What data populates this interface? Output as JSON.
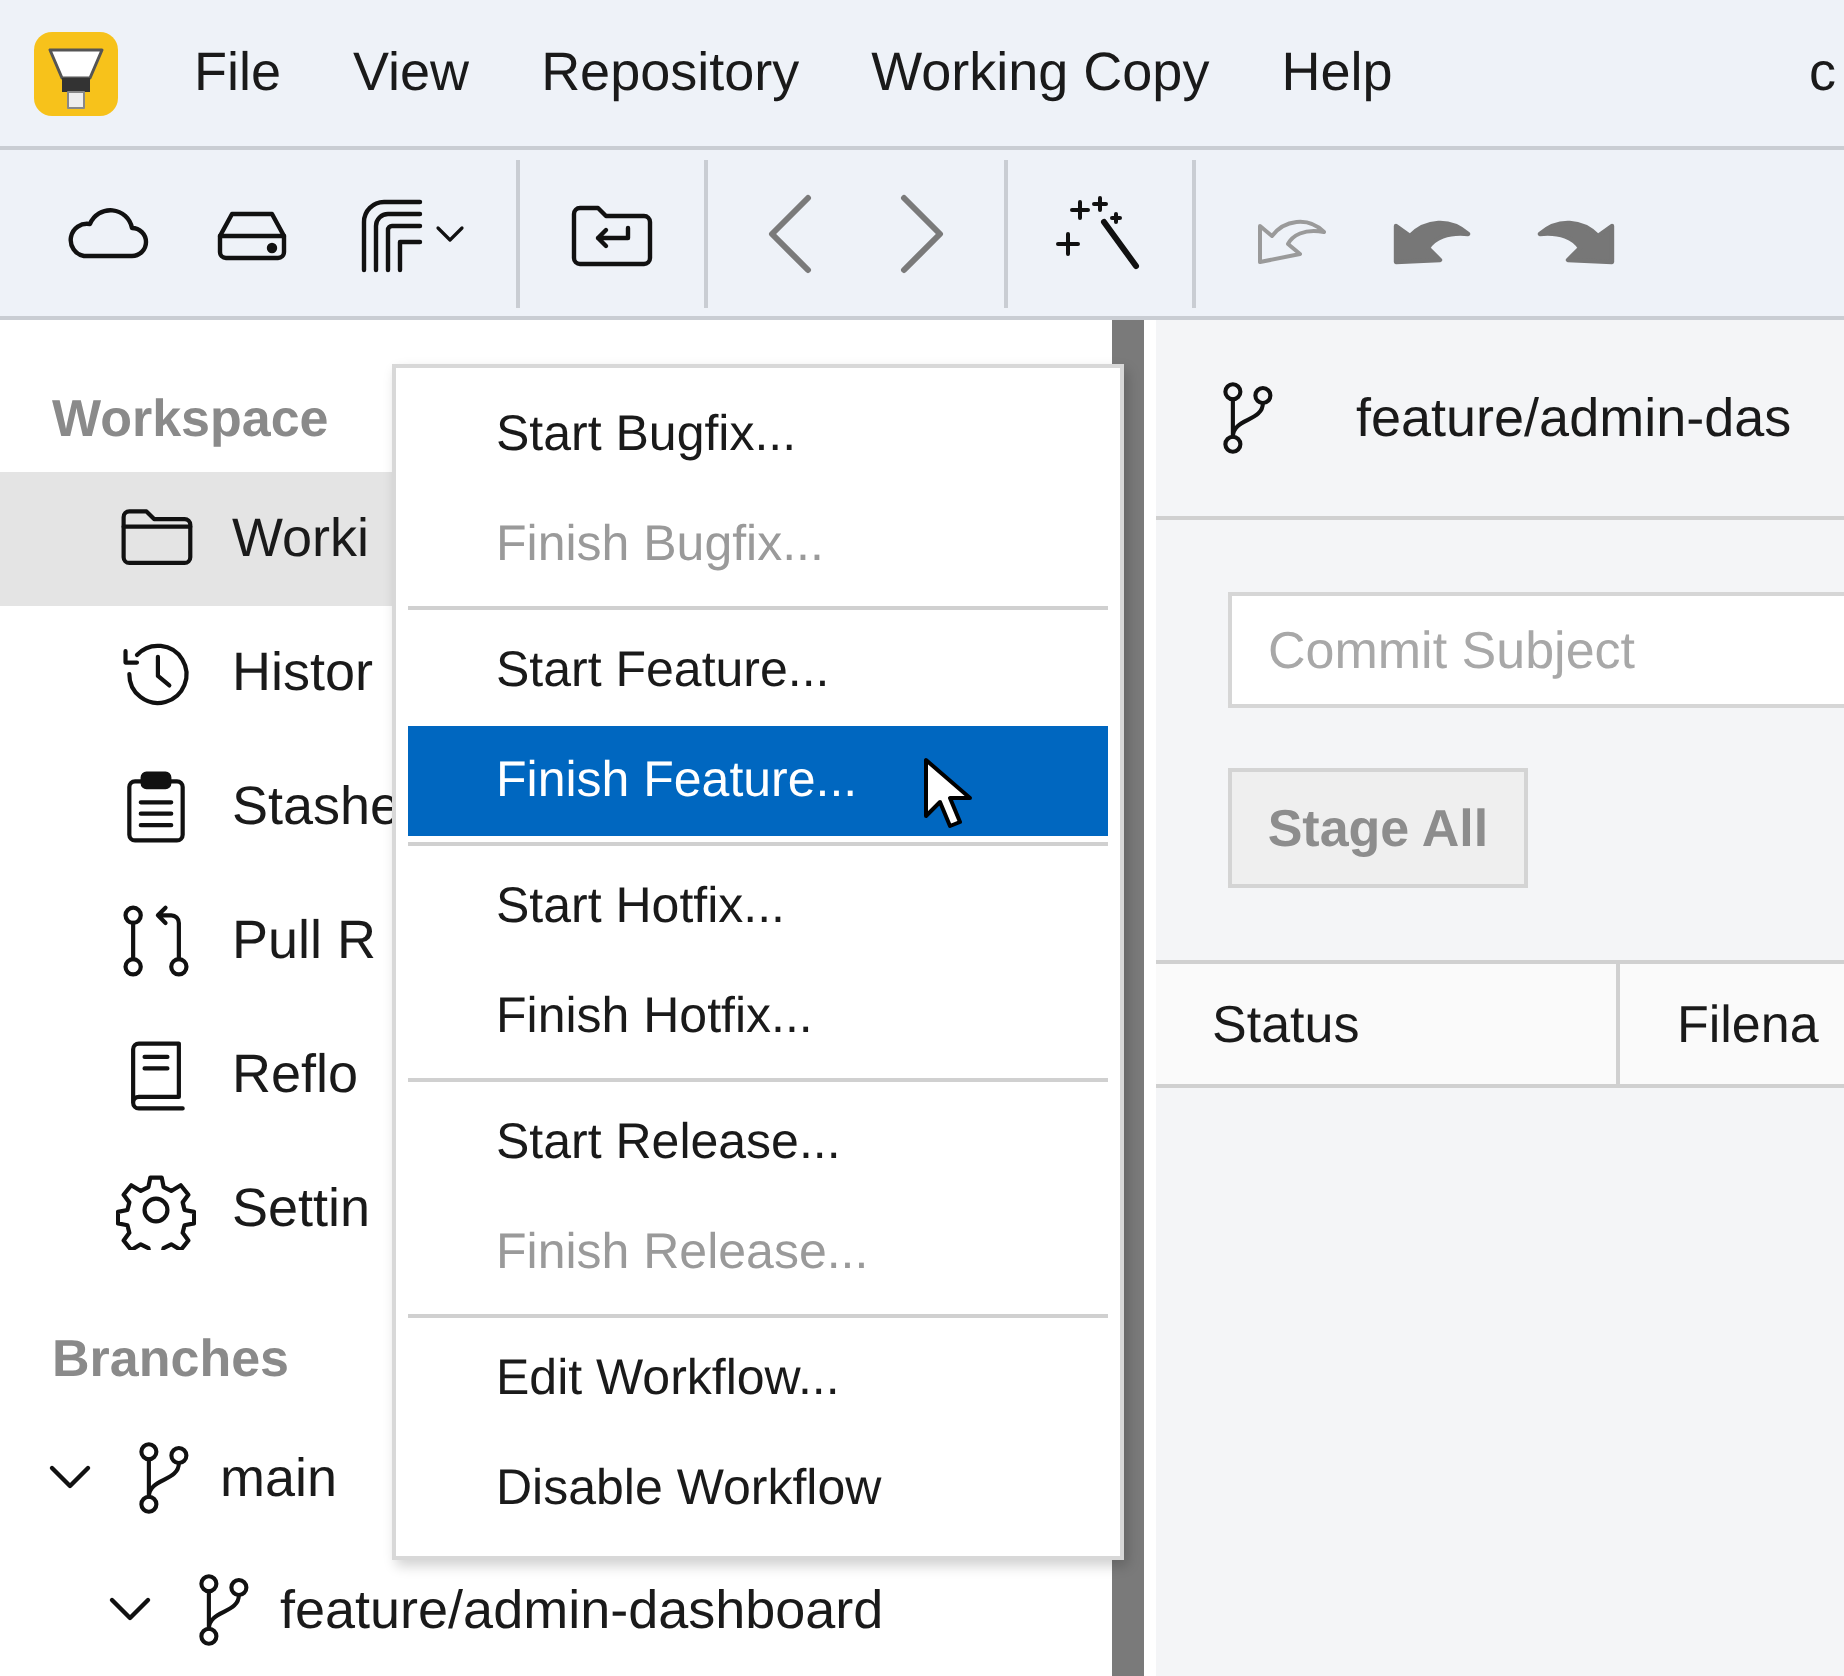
{
  "menu_bar": {
    "items": [
      "File",
      "View",
      "Repository",
      "Working Copy",
      "Help"
    ],
    "cut_item": "c"
  },
  "sidebar": {
    "workspace": {
      "title": "Workspace",
      "items": [
        {
          "label": "Worki",
          "selected": true
        },
        {
          "label": "Histor",
          "selected": false
        },
        {
          "label": "Stashe",
          "selected": false
        },
        {
          "label": "Pull R",
          "selected": false
        },
        {
          "label": "Reflo",
          "selected": false
        },
        {
          "label": "Settin",
          "selected": false
        }
      ]
    },
    "branches": {
      "title": "Branches",
      "tree": [
        {
          "label": "main",
          "expanded": true,
          "children": [
            {
              "label": "feature/admin-dashboard",
              "expanded": true
            }
          ]
        }
      ]
    }
  },
  "context_menu": {
    "groups": [
      [
        {
          "label": "Start Bugfix...",
          "disabled": false,
          "selected": false
        },
        {
          "label": "Finish Bugfix...",
          "disabled": true,
          "selected": false
        }
      ],
      [
        {
          "label": "Start Feature...",
          "disabled": false,
          "selected": false
        },
        {
          "label": "Finish Feature...",
          "disabled": false,
          "selected": true
        }
      ],
      [
        {
          "label": "Start Hotfix...",
          "disabled": false,
          "selected": false
        },
        {
          "label": "Finish Hotfix...",
          "disabled": false,
          "selected": false
        }
      ],
      [
        {
          "label": "Start Release...",
          "disabled": false,
          "selected": false
        },
        {
          "label": "Finish Release...",
          "disabled": true,
          "selected": false
        }
      ],
      [
        {
          "label": "Edit Workflow...",
          "disabled": false,
          "selected": false
        },
        {
          "label": "Disable Workflow",
          "disabled": false,
          "selected": false
        }
      ]
    ]
  },
  "main": {
    "branch": "feature/admin-das",
    "commit_subject": {
      "placeholder": "Commit Subject"
    },
    "stage_all": {
      "label": "Stage All",
      "disabled": true
    },
    "columns": [
      "Status",
      "Filena"
    ]
  }
}
